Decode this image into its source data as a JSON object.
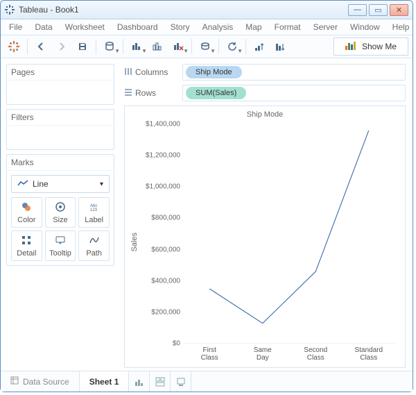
{
  "window": {
    "title": "Tableau - Book1"
  },
  "menubar": [
    "File",
    "Data",
    "Worksheet",
    "Dashboard",
    "Story",
    "Analysis",
    "Map",
    "Format",
    "Server",
    "Window",
    "Help"
  ],
  "toolbar": {
    "show_me": "Show Me"
  },
  "sidebar": {
    "pages_label": "Pages",
    "filters_label": "Filters",
    "marks_label": "Marks",
    "marks_type": "Line",
    "mark_cells": [
      "Color",
      "Size",
      "Label",
      "Detail",
      "Tooltip",
      "Path"
    ]
  },
  "shelves": {
    "columns_label": "Columns",
    "rows_label": "Rows",
    "column_pill": "Ship Mode",
    "row_pill": "SUM(Sales)"
  },
  "tabs": {
    "data_source": "Data Source",
    "sheet1": "Sheet 1"
  },
  "chart_data": {
    "type": "line",
    "title": "Ship Mode",
    "ylabel": "Sales",
    "xlabel": "",
    "ylim": [
      0,
      1400000
    ],
    "categories": [
      "First Class",
      "Same Day",
      "Second Class",
      "Standard Class"
    ],
    "values": [
      350000,
      130000,
      460000,
      1360000
    ],
    "yticks": [
      0,
      200000,
      400000,
      600000,
      800000,
      1000000,
      1200000,
      1400000
    ],
    "ytick_labels": [
      "$0",
      "$200,000",
      "$400,000",
      "$600,000",
      "$800,000",
      "$1,000,000",
      "$1,200,000",
      "$1,400,000"
    ]
  }
}
